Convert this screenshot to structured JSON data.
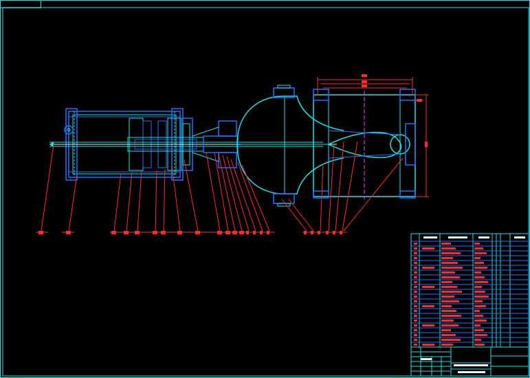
{
  "drawing": {
    "colors": {
      "background": "#000000",
      "frame": "#16e6e6",
      "outline": "#1e73ff",
      "detail": "#16e6e6",
      "centerline": "#f2f2f2",
      "annotation": "#ff2a2a",
      "axis": "#ff3cff"
    }
  }
}
